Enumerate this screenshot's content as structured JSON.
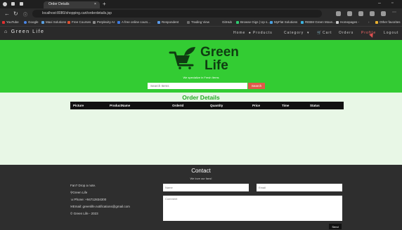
{
  "browser": {
    "tab_title": "Order Details",
    "url": "localhost:8080/shopping.cart/orderdetails.jsp",
    "bookmarks": [
      "YouTube",
      "Google",
      "Maxi Solutions",
      "Free Courses",
      "Perplexity AI",
      "A free online cours...",
      "Respondent",
      "Trading View",
      "GitHub",
      "Browse Gigs | Up s...",
      "MyFlat Solutions",
      "REBM Green Move...",
      "Homepages -",
      "Other favorites"
    ]
  },
  "navbar": {
    "brand": "Green Life",
    "links": {
      "home": "Home",
      "products": "Products",
      "category": "Category",
      "cart": "Cart",
      "orders": "Orders",
      "profile": "Profile",
      "logout": "Logout"
    }
  },
  "hero": {
    "logo_line1": "Green",
    "logo_line2": "Life",
    "tagline": "We specialize in Fresh Items",
    "search_placeholder": "Search Items",
    "search_button": "Search"
  },
  "orders": {
    "title": "Order Details",
    "columns": [
      "Picture",
      "ProductName",
      "OrderId",
      "Quantity",
      "Price",
      "Time",
      "Status"
    ],
    "rows": []
  },
  "footer": {
    "contact_title": "Contact",
    "contact_subtitle": "We love our fans!",
    "tagline": "Fan? Drop a note.",
    "company": "Green Life",
    "phone": "Phone: +94712834300",
    "email": "Email: greenlife.notifications@gmail.com",
    "copyright": "Green Life - 2023",
    "name_placeholder": "Name",
    "email_placeholder": "Email",
    "comment_placeholder": "Comment",
    "send_button": "Send"
  },
  "colors": {
    "hero_green": "#33cc33",
    "logo_dark_green": "#0f3d12",
    "orders_title_green": "#23a823",
    "orders_bg": "#e8f7e6",
    "search_button_red": "#e05a4a",
    "navbar_bg": "#2a2a2a",
    "footer_bg": "#2e2e2e"
  }
}
